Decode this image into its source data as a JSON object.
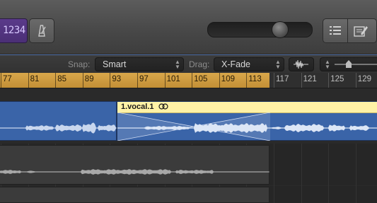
{
  "lcd": {
    "text": "1234"
  },
  "toolbar": {
    "snap_label": "Snap:",
    "snap_value": "Smart",
    "drag_label": "Drag:",
    "drag_value": "X-Fade"
  },
  "ruler": {
    "cycle_marks": [
      "77",
      "81",
      "85",
      "89",
      "93",
      "97",
      "101",
      "105",
      "109",
      "113"
    ],
    "marks": [
      "117",
      "121",
      "125",
      "129"
    ]
  },
  "regions": {
    "vocal_name": "1.vocal.1"
  },
  "colors": {
    "cycle": "#d9a74a",
    "audio_region": "#3a64a8",
    "selected_header": "#fff2a6",
    "lcd": "#4b2f76"
  },
  "icons": [
    "metronome-icon",
    "list-editors-icon",
    "note-pad-icon",
    "waveform-zoom-icon",
    "loop-icon"
  ]
}
